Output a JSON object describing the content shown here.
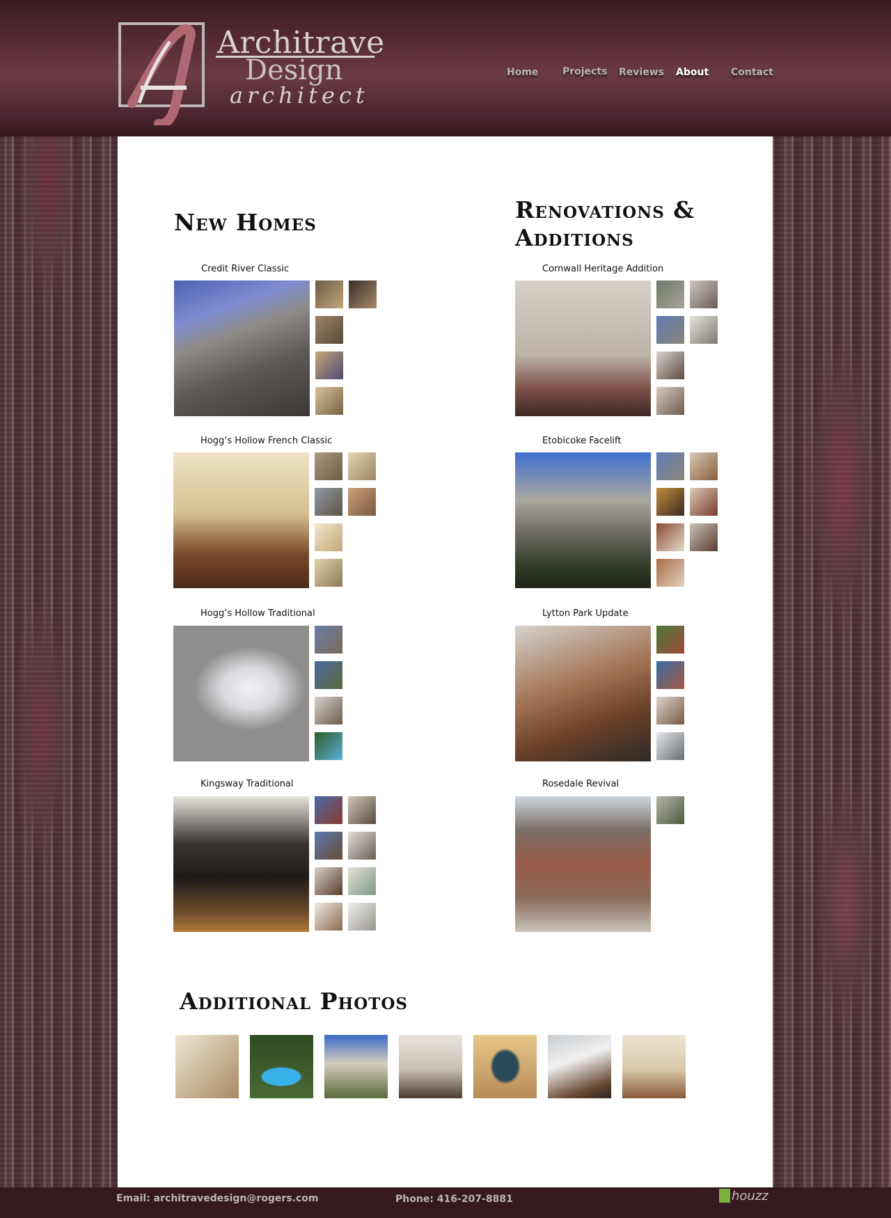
{
  "brand": {
    "line1": "Architrave",
    "line2": "Design",
    "line3": "architect",
    "monogram": "A"
  },
  "nav": {
    "home": "Home",
    "projects": "Projects",
    "reviews": "Reviews",
    "about": "About",
    "contact": "Contact",
    "active": "About"
  },
  "sections": {
    "new_homes": "New Homes",
    "renovations": "Renovations & Additions",
    "additional": "Additional Photos"
  },
  "projects": {
    "credit_river": "Credit River Classic",
    "cornwall": "Cornwall Heritage Addition",
    "hoggs_french": "Hogg’s Hollow French Classic",
    "etobicoke": "Etobicoke Facelift",
    "hoggs_traditional": "Hogg’s Hollow Traditional",
    "lytton": "Lytton Park Update",
    "kingsway": "Kingsway Traditional",
    "rosedale": "Rosedale Revival"
  },
  "footer": {
    "email": "Email: architravedesign@rogers.com",
    "phone": "Phone: 416-207-8881",
    "houzz": "houzz"
  },
  "colors": {
    "header": "#5a2e38",
    "footer": "#36181f",
    "logo_accent": "#b06872",
    "wood": "#6b4a50"
  }
}
